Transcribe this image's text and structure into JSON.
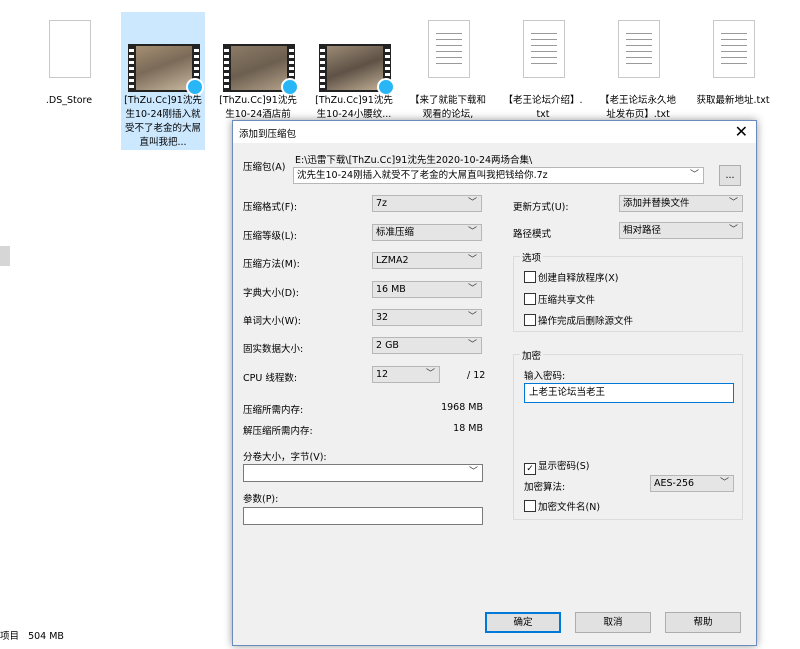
{
  "files": [
    {
      "name": ".DS_Store",
      "type": "blank"
    },
    {
      "name": "[ThZu.Cc]91沈先生10-24刚插入就受不了老金的大屌直叫我把...",
      "type": "video"
    },
    {
      "name": "[ThZu.Cc]91沈先生10-24酒店前台...",
      "type": "video"
    },
    {
      "name": "[ThZu.Cc]91沈先生10-24小腰纹...",
      "type": "video"
    },
    {
      "name": "【来了就能下载和观看的论坛,",
      "type": "doc"
    },
    {
      "name": "【老王论坛介绍】.txt",
      "type": "doc"
    },
    {
      "name": "【老王论坛永久地址发布页】.txt",
      "type": "doc"
    },
    {
      "name": "获取最新地址.txt",
      "type": "doc"
    }
  ],
  "status_bar": {
    "items_text": "项目",
    "size": "504 MB"
  },
  "dialog": {
    "title": "添加到压缩包",
    "close": "✕",
    "archive_label": "压缩包(A)",
    "archive_dir": "E:\\迅雷下载\\[ThZu.Cc]91沈先生2020-10-24两场合集\\",
    "archive_name": "沈先生10-24刚插入就受不了老金的大屌直叫我把钱给你.7z",
    "browse": "...",
    "left": [
      {
        "label": "压缩格式(F):",
        "value": "7z"
      },
      {
        "label": "压缩等级(L):",
        "value": "标准压缩"
      },
      {
        "label": "压缩方法(M):",
        "value": "LZMA2"
      },
      {
        "label": "字典大小(D):",
        "value": "16 MB"
      },
      {
        "label": "单词大小(W):",
        "value": "32"
      },
      {
        "label": "固实数据大小:",
        "value": "2 GB"
      }
    ],
    "cpu": {
      "label": "CPU 线程数:",
      "value": "12",
      "max": "/ 12"
    },
    "mem_compress": {
      "label": "压缩所需内存:",
      "value": "1968 MB"
    },
    "mem_decompress": {
      "label": "解压缩所需内存:",
      "value": "18 MB"
    },
    "split": {
      "label": "分卷大小，字节(V):",
      "value": ""
    },
    "params": {
      "label": "参数(P):",
      "value": ""
    },
    "update": {
      "label": "更新方式(U):",
      "value": "添加并替换文件"
    },
    "path_mode": {
      "label": "路径模式",
      "value": "相对路径"
    },
    "options": {
      "title": "选项",
      "items": [
        {
          "label": "创建自释放程序(X)",
          "checked": false
        },
        {
          "label": "压缩共享文件",
          "checked": false
        },
        {
          "label": "操作完成后删除源文件",
          "checked": false
        }
      ]
    },
    "encryption": {
      "title": "加密",
      "pwd_label": "输入密码:",
      "pwd_value": "上老王论坛当老王",
      "show_pwd": "显示密码(S)",
      "show_pwd_checked": "✓",
      "algo_label": "加密算法:",
      "algo_value": "AES-256",
      "encrypt_names": "加密文件名(N)"
    },
    "buttons": {
      "ok": "确定",
      "cancel": "取消",
      "help": "帮助"
    },
    "arrow": "﹀"
  }
}
